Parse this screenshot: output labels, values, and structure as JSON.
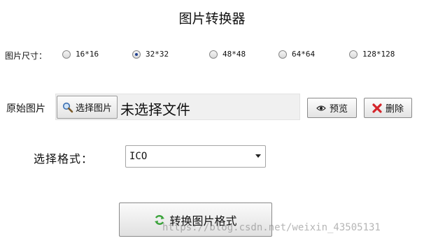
{
  "title": "图片转换器",
  "image_size": {
    "label": "图片尺寸：",
    "options": [
      "16*16",
      "32*32",
      "48*48",
      "64*64",
      "128*128"
    ],
    "selected": "32*32"
  },
  "original_image": {
    "label": "原始图片",
    "choose_button": "选择图片",
    "file_status": "未选择文件",
    "preview_button": "预览",
    "delete_button": "删除"
  },
  "format": {
    "label": "选择格式：",
    "selected": "ICO"
  },
  "convert_button": "转换图片格式",
  "watermark": "https://blog.csdn.net/weixin_43505131",
  "colors": {
    "delete_icon": "#d4242a",
    "convert_icon": "#3aa33a",
    "radio_dot": "#1f3f8f"
  }
}
